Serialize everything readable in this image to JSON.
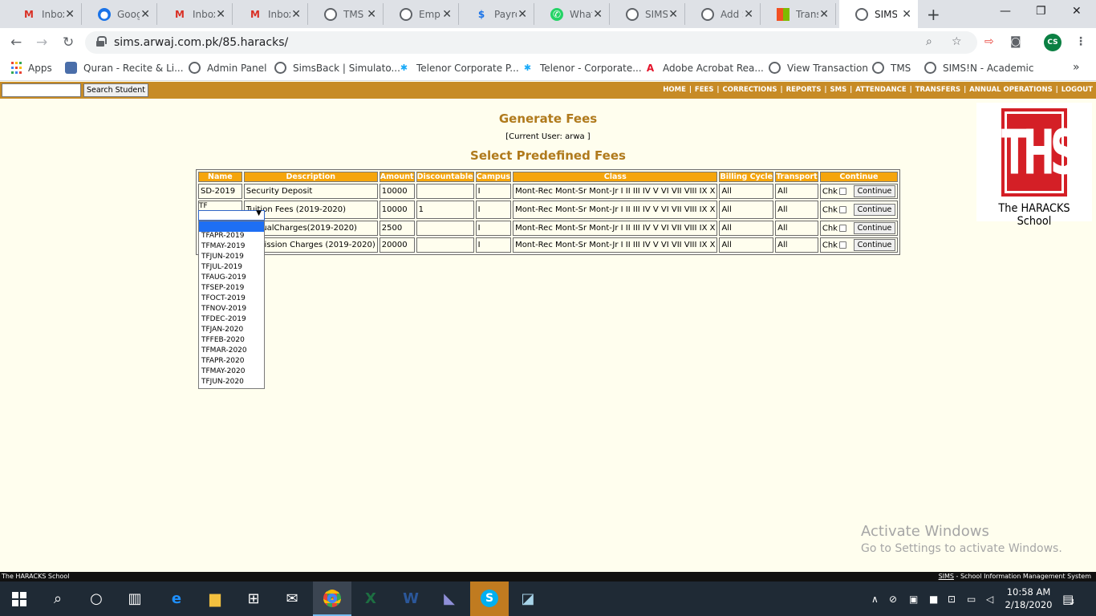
{
  "browser": {
    "tabs": [
      {
        "title": "Inbox",
        "icon": "gmail-icon"
      },
      {
        "title": "Google",
        "icon": "google-account-icon"
      },
      {
        "title": "Inbox",
        "icon": "gmail-icon"
      },
      {
        "title": "Inbox",
        "icon": "gmail-icon"
      },
      {
        "title": "TMS",
        "icon": "globe-icon"
      },
      {
        "title": "Employee",
        "icon": "globe-icon"
      },
      {
        "title": "Payroll",
        "icon": "payroll-icon"
      },
      {
        "title": "WhatsApp",
        "icon": "whatsapp-icon"
      },
      {
        "title": "SIMS",
        "icon": "globe-icon"
      },
      {
        "title": "Add S",
        "icon": "globe-icon"
      },
      {
        "title": "Transp",
        "icon": "microsoft-icon"
      },
      {
        "title": "SIMS",
        "icon": "globe-icon"
      }
    ],
    "active_tab_index": 11,
    "url": "sims.arwaj.com.pk/85.haracks/",
    "profile_initials": "CS",
    "bookmarks": [
      {
        "label": "Apps",
        "icon": "apps-grid-icon"
      },
      {
        "label": "Quran - Recite & Li...",
        "icon": "quran-icon"
      },
      {
        "label": "Admin Panel",
        "icon": "globe-icon"
      },
      {
        "label": "SimsBack | Simulato...",
        "icon": "globe-icon"
      },
      {
        "label": "Telenor Corporate P...",
        "icon": "telenor-icon"
      },
      {
        "label": "Telenor - Corporate...",
        "icon": "telenor-icon"
      },
      {
        "label": "Adobe Acrobat Rea...",
        "icon": "adobe-icon"
      },
      {
        "label": "View Transaction",
        "icon": "globe-icon"
      },
      {
        "label": "TMS",
        "icon": "globe-icon"
      },
      {
        "label": "SIMS!N - Academic",
        "icon": "globe-icon"
      }
    ]
  },
  "site": {
    "search_button": "Search Student",
    "search_value": "",
    "nav": [
      "HOME",
      "FEES",
      "CORRECTIONS",
      "REPORTS",
      "SMS",
      "ATTENDANCE",
      "TRANSFERS",
      "ANNUAL OPERATIONS",
      "LOGOUT"
    ],
    "title": "Generate Fees",
    "current_user": "[Current User: arwa ]",
    "subtitle": "Select Predefined Fees",
    "logo": {
      "letters": "THS",
      "name": "The HARACKS School",
      "color": "#d41f26"
    },
    "accent_color": "#c78b26",
    "header_color": "#f5a50c"
  },
  "fees_table": {
    "headers": [
      "Name",
      "Description",
      "Amount",
      "Discountable",
      "Campus",
      "Class",
      "Billing Cycle",
      "Transport",
      "Continue"
    ],
    "rows": [
      {
        "name": "SD-2019",
        "description": "Security Deposit",
        "amount": "10000",
        "discountable": "",
        "campus": "I",
        "class": "Mont-Rec Mont-Sr Mont-Jr I II III IV V VI VII VIII IX X",
        "billing_cycle": "All",
        "transport": "All",
        "chk_label": "Chk",
        "button": "Continue"
      },
      {
        "name": "TF",
        "description": "Tuition Fees (2019-2020)",
        "amount": "10000",
        "discountable": "1",
        "campus": "I",
        "class": "Mont-Rec Mont-Sr Mont-Jr I II III IV V VI VII VIII IX X",
        "billing_cycle": "All",
        "transport": "All",
        "chk_label": "Chk",
        "button": "Continue"
      },
      {
        "name": "",
        "description": "AnnualCharges(2019-2020)",
        "amount": "2500",
        "discountable": "",
        "campus": "I",
        "class": "Mont-Rec Mont-Sr Mont-Jr I II III IV V VI VII VIII IX X",
        "billing_cycle": "All",
        "transport": "All",
        "chk_label": "Chk",
        "button": "Continue"
      },
      {
        "name": "",
        "description": "Admission Charges (2019-2020)",
        "amount": "20000",
        "discountable": "",
        "campus": "I",
        "class": "Mont-Rec Mont-Sr Mont-Jr I II III IV V VI VII VIII IX X",
        "billing_cycle": "All",
        "transport": "All",
        "chk_label": "Chk",
        "button": "Continue"
      }
    ]
  },
  "dropdown": {
    "selected": "",
    "options": [
      "",
      "TFAPR-2019",
      "TFMAY-2019",
      "TFJUN-2019",
      "TFJUL-2019",
      "TFAUG-2019",
      "TFSEP-2019",
      "TFOCT-2019",
      "TFNOV-2019",
      "TFDEC-2019",
      "TFJAN-2020",
      "TFFEB-2020",
      "TFMAR-2020",
      "TFAPR-2020",
      "TFMAY-2020",
      "TFJUN-2020"
    ]
  },
  "watermark": {
    "line1": "Activate Windows",
    "line2": "Go to Settings to activate Windows."
  },
  "footer": {
    "left": "The HARACKS School",
    "right_abbr": "SIMS",
    "right_rest": " - School Information Management System"
  },
  "taskbar": {
    "time": "10:58 AM",
    "date": "2/18/2020",
    "notifications": "3"
  }
}
